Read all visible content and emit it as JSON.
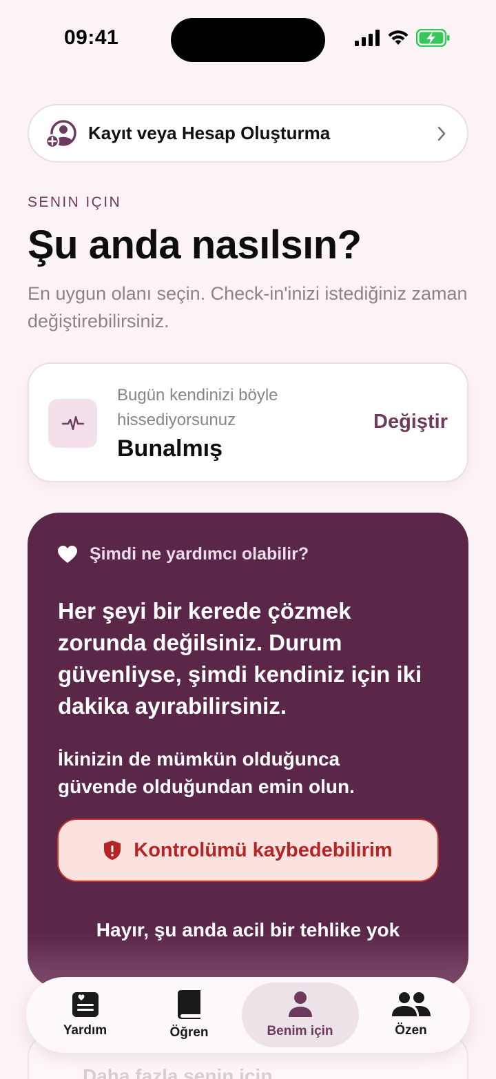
{
  "status_bar": {
    "time": "09:41"
  },
  "signin": {
    "label": "Kayıt veya Hesap Oluşturma"
  },
  "section_label": "SENIN IÇIN",
  "headline": "Şu anda nasılsın?",
  "subtext": "En uygun olanı seçin. Check-in'inizi istediğiniz zaman değiştirebilirsiniz.",
  "checkin": {
    "caption": "Bugün kendinizi böyle hissediyorsunuz",
    "value": "Bunalmış",
    "change_label": "Değiştir"
  },
  "help_card": {
    "heading": "Şimdi ne yardımcı olabilir?",
    "message": "Her şeyi bir kerede çözmek zorunda değilsiniz. Durum güvenliyse, şimdi kendiniz için iki dakika ayırabilirsiniz.",
    "note": "İkinizin de mümkün olduğunca güvende olduğundan emin olun.",
    "danger_button": "Kontrolümü kaybedebilirim",
    "safe_button": "Hayır, şu anda acil bir tehlike yok"
  },
  "peek": {
    "label": "Daha fazla senin için"
  },
  "tabs": [
    {
      "label": "Yardım",
      "icon": "help-card-icon"
    },
    {
      "label": "Öğren",
      "icon": "book-icon"
    },
    {
      "label": "Benim için",
      "icon": "person-icon",
      "active": true
    },
    {
      "label": "Özen",
      "icon": "people-icon"
    }
  ],
  "colors": {
    "background": "#fcf3f7",
    "accent": "#6d3a5c",
    "card_dark": "#5a2749",
    "danger": "#b52526",
    "battery": "#34c759"
  }
}
